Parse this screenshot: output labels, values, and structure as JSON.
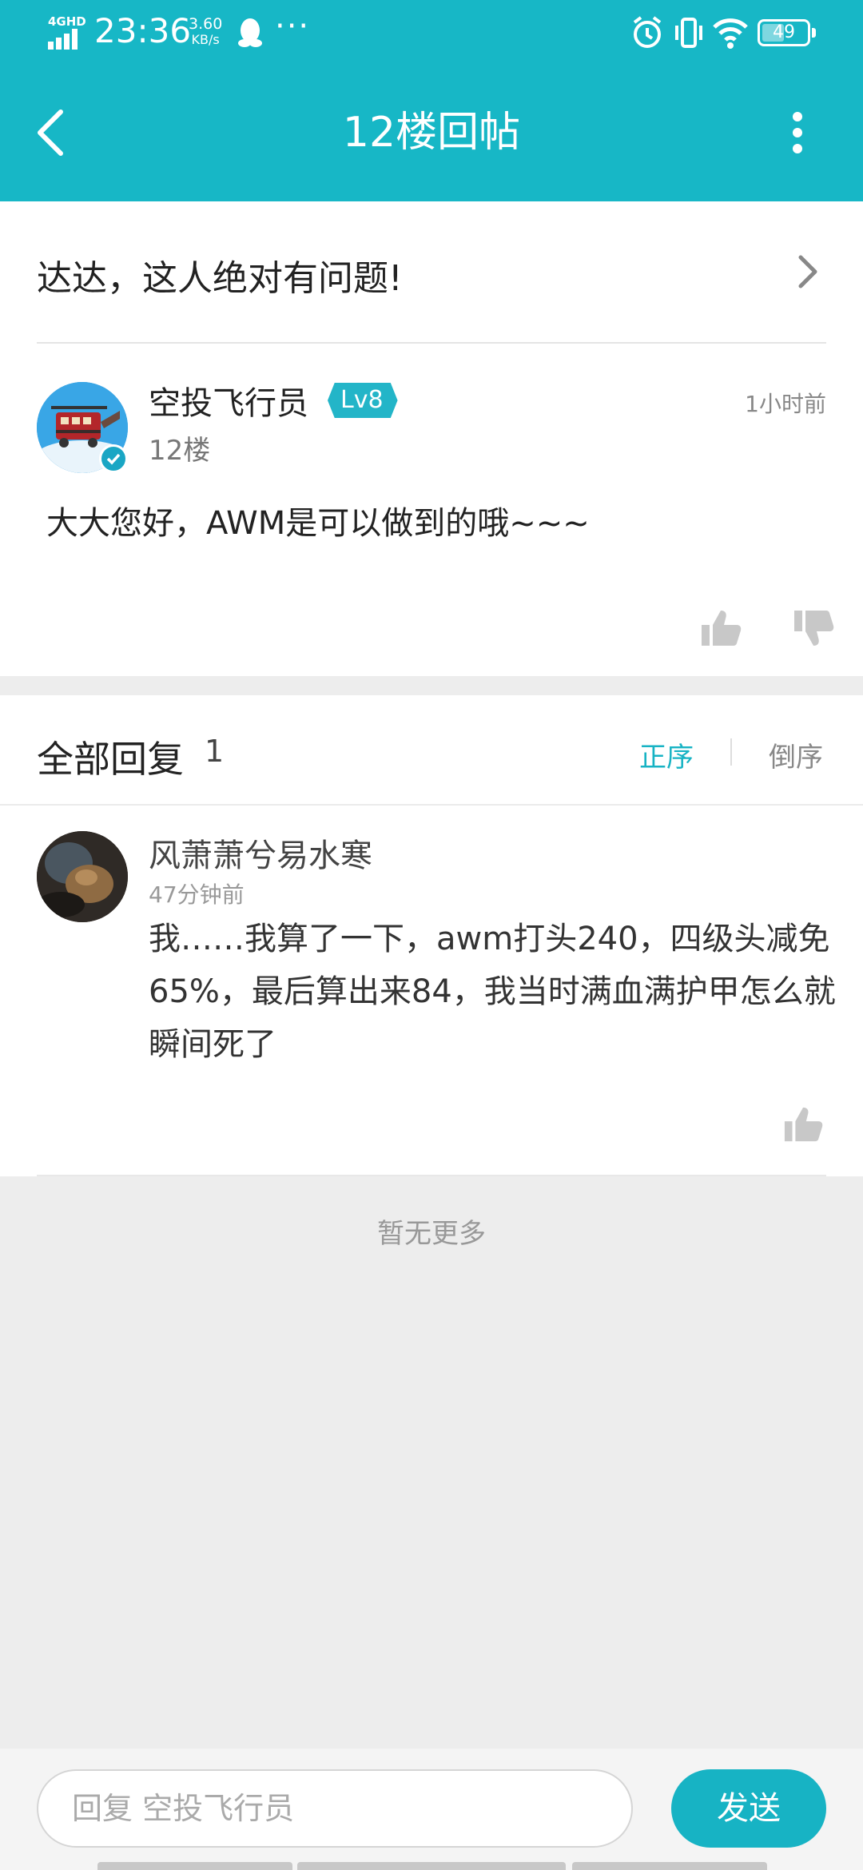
{
  "status_bar": {
    "network": "4GHD",
    "time": "23:36",
    "speed_value": "3.60",
    "speed_unit": "KB/s",
    "more": "···",
    "battery": "49"
  },
  "nav": {
    "title": "12楼回帖"
  },
  "thread": {
    "title": "达达，这人绝对有问题!"
  },
  "post": {
    "author": "空投飞行员",
    "level": "Lv8",
    "floor": "12楼",
    "time": "1小时前",
    "content": "大大您好，AWM是可以做到的哦~~~"
  },
  "replies": {
    "title": "全部回复",
    "count": "1",
    "sort_asc": "正序",
    "sort_desc": "倒序",
    "items": [
      {
        "author": "风萧萧兮易水寒",
        "time": "47分钟前",
        "content": "我……我算了一下，awm打头240，四级头减免65%，最后算出来84，我当时满血满护甲怎么就瞬间死了"
      }
    ]
  },
  "footer_text": "暂无更多",
  "reply_bar": {
    "placeholder": "回复 空投飞行员",
    "send": "发送"
  },
  "colors": {
    "accent": "#17b7c6",
    "page_bg": "#ededed"
  }
}
